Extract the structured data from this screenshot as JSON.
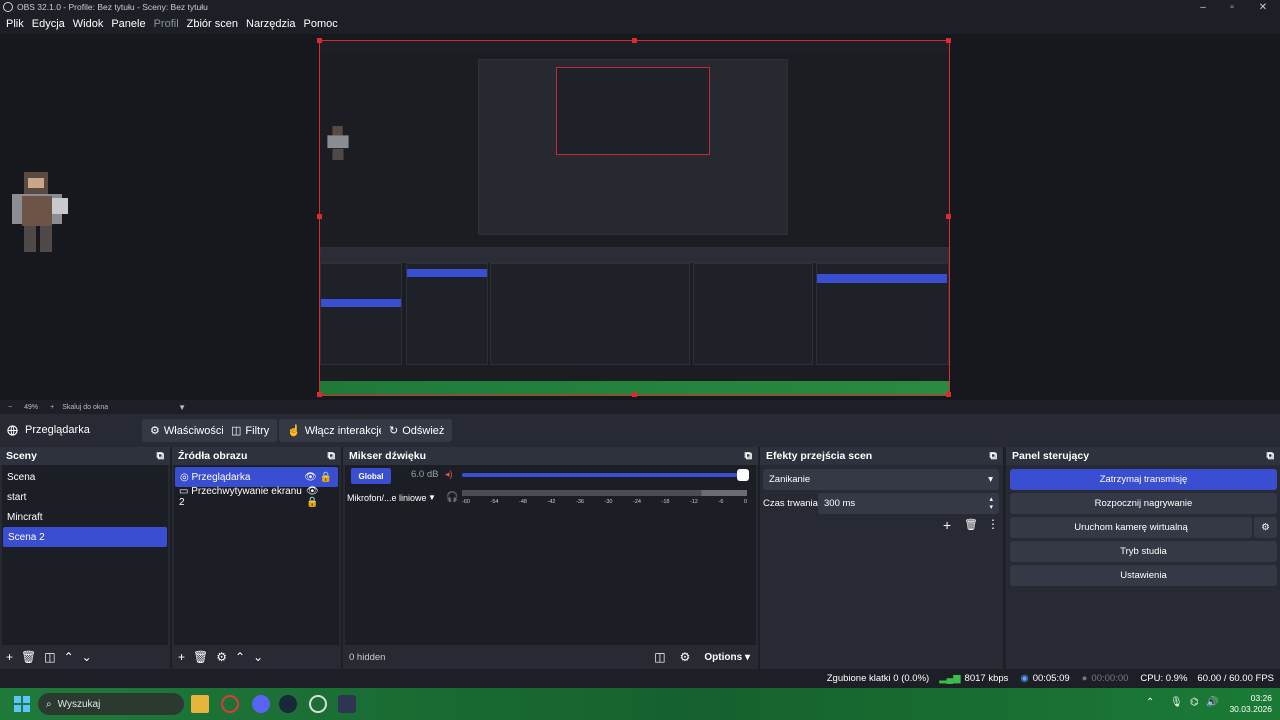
{
  "window": {
    "title": "OBS 32.1.0 - Profile: Bez tytułu - Sceny: Bez tytułu",
    "controls": [
      "–",
      "▫",
      "✕"
    ]
  },
  "menu": [
    "Plik",
    "Edycja",
    "Widok",
    "Panele",
    "Profil",
    "Zbiór scen",
    "Narzędzia",
    "Pomoc"
  ],
  "zoom": {
    "value": "49%",
    "scale_label": "Skaluj do okna"
  },
  "source_bar": {
    "name": "Przeglądarka",
    "buttons": [
      "Właściwości",
      "Filtry",
      "Włącz interakcję",
      "Odśwież"
    ]
  },
  "scenes": {
    "title": "Sceny",
    "items": [
      "Scena",
      "start",
      "Mincraft",
      "Scena 2"
    ],
    "selected": 3
  },
  "sources": {
    "title": "Źródła obrazu",
    "items": [
      "Przeglądarka",
      "Przechwytywanie ekranu 2"
    ],
    "selected": 0
  },
  "mixer": {
    "title": "Mikser dźwięku",
    "global_label": "Global",
    "global_db": "6.0 dB",
    "mic_label": "Mikrofon/...e liniowe",
    "scale": [
      "-60",
      "-54",
      "-48",
      "-42",
      "-36",
      "-30",
      "-24",
      "-18",
      "-12",
      "-6",
      "0"
    ],
    "hidden_label": "0 hidden",
    "options_label": "Options"
  },
  "transitions": {
    "title": "Efekty przejścia scen",
    "selected": "Zanikanie",
    "duration_label": "Czas trwania",
    "duration_value": "300 ms"
  },
  "controls": {
    "title": "Panel sterujący",
    "buttons": [
      "Zatrzymaj transmisję",
      "Rozpocznij nagrywanie",
      "Uruchom kamerę wirtualną",
      "Tryb studia",
      "Ustawienia"
    ]
  },
  "status": {
    "dropped": "Zgubione klatki 0 (0.0%)",
    "bitrate": "8017 kbps",
    "stream_time": "00:05:09",
    "rec_time": "00:00:00",
    "cpu": "CPU: 0.9%",
    "fps": "60.00 / 60.00 FPS"
  },
  "taskbar": {
    "search_placeholder": "Wyszukaj",
    "time": "03:26",
    "date": "30.03.2026"
  },
  "colors": {
    "accent": "#3a4ed1",
    "preview_border": "#e0282f",
    "panel_bg": "#272a33",
    "taskbar": "#1f7a3a"
  }
}
